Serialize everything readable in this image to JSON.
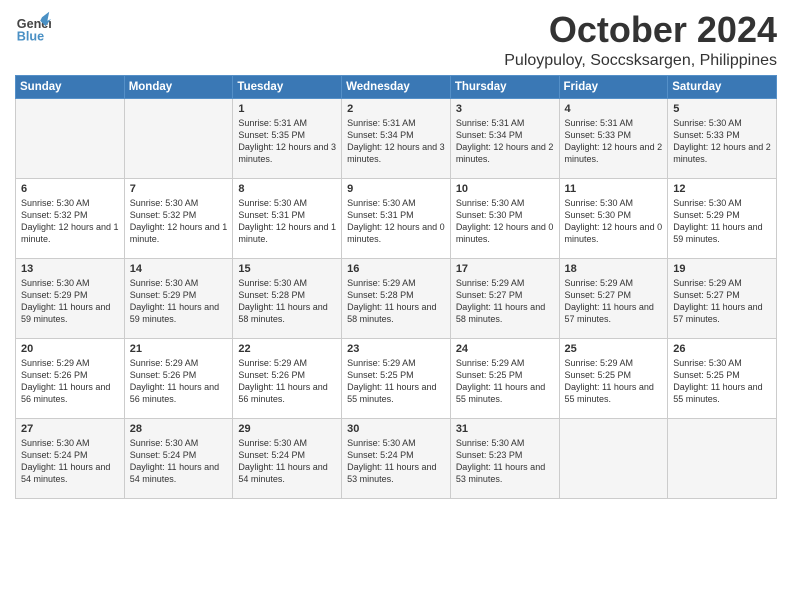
{
  "header": {
    "logo_line1": "General",
    "logo_line2": "Blue",
    "month": "October 2024",
    "location": "Puloypuloy, Soccsksargen, Philippines"
  },
  "weekdays": [
    "Sunday",
    "Monday",
    "Tuesday",
    "Wednesday",
    "Thursday",
    "Friday",
    "Saturday"
  ],
  "weeks": [
    [
      {
        "day": "",
        "content": ""
      },
      {
        "day": "",
        "content": ""
      },
      {
        "day": "1",
        "content": "Sunrise: 5:31 AM\nSunset: 5:35 PM\nDaylight: 12 hours\nand 3 minutes."
      },
      {
        "day": "2",
        "content": "Sunrise: 5:31 AM\nSunset: 5:34 PM\nDaylight: 12 hours\nand 3 minutes."
      },
      {
        "day": "3",
        "content": "Sunrise: 5:31 AM\nSunset: 5:34 PM\nDaylight: 12 hours\nand 2 minutes."
      },
      {
        "day": "4",
        "content": "Sunrise: 5:31 AM\nSunset: 5:33 PM\nDaylight: 12 hours\nand 2 minutes."
      },
      {
        "day": "5",
        "content": "Sunrise: 5:30 AM\nSunset: 5:33 PM\nDaylight: 12 hours\nand 2 minutes."
      }
    ],
    [
      {
        "day": "6",
        "content": "Sunrise: 5:30 AM\nSunset: 5:32 PM\nDaylight: 12 hours\nand 1 minute."
      },
      {
        "day": "7",
        "content": "Sunrise: 5:30 AM\nSunset: 5:32 PM\nDaylight: 12 hours\nand 1 minute."
      },
      {
        "day": "8",
        "content": "Sunrise: 5:30 AM\nSunset: 5:31 PM\nDaylight: 12 hours\nand 1 minute."
      },
      {
        "day": "9",
        "content": "Sunrise: 5:30 AM\nSunset: 5:31 PM\nDaylight: 12 hours\nand 0 minutes."
      },
      {
        "day": "10",
        "content": "Sunrise: 5:30 AM\nSunset: 5:30 PM\nDaylight: 12 hours\nand 0 minutes."
      },
      {
        "day": "11",
        "content": "Sunrise: 5:30 AM\nSunset: 5:30 PM\nDaylight: 12 hours\nand 0 minutes."
      },
      {
        "day": "12",
        "content": "Sunrise: 5:30 AM\nSunset: 5:29 PM\nDaylight: 11 hours\nand 59 minutes."
      }
    ],
    [
      {
        "day": "13",
        "content": "Sunrise: 5:30 AM\nSunset: 5:29 PM\nDaylight: 11 hours\nand 59 minutes."
      },
      {
        "day": "14",
        "content": "Sunrise: 5:30 AM\nSunset: 5:29 PM\nDaylight: 11 hours\nand 59 minutes."
      },
      {
        "day": "15",
        "content": "Sunrise: 5:30 AM\nSunset: 5:28 PM\nDaylight: 11 hours\nand 58 minutes."
      },
      {
        "day": "16",
        "content": "Sunrise: 5:29 AM\nSunset: 5:28 PM\nDaylight: 11 hours\nand 58 minutes."
      },
      {
        "day": "17",
        "content": "Sunrise: 5:29 AM\nSunset: 5:27 PM\nDaylight: 11 hours\nand 58 minutes."
      },
      {
        "day": "18",
        "content": "Sunrise: 5:29 AM\nSunset: 5:27 PM\nDaylight: 11 hours\nand 57 minutes."
      },
      {
        "day": "19",
        "content": "Sunrise: 5:29 AM\nSunset: 5:27 PM\nDaylight: 11 hours\nand 57 minutes."
      }
    ],
    [
      {
        "day": "20",
        "content": "Sunrise: 5:29 AM\nSunset: 5:26 PM\nDaylight: 11 hours\nand 56 minutes."
      },
      {
        "day": "21",
        "content": "Sunrise: 5:29 AM\nSunset: 5:26 PM\nDaylight: 11 hours\nand 56 minutes."
      },
      {
        "day": "22",
        "content": "Sunrise: 5:29 AM\nSunset: 5:26 PM\nDaylight: 11 hours\nand 56 minutes."
      },
      {
        "day": "23",
        "content": "Sunrise: 5:29 AM\nSunset: 5:25 PM\nDaylight: 11 hours\nand 55 minutes."
      },
      {
        "day": "24",
        "content": "Sunrise: 5:29 AM\nSunset: 5:25 PM\nDaylight: 11 hours\nand 55 minutes."
      },
      {
        "day": "25",
        "content": "Sunrise: 5:29 AM\nSunset: 5:25 PM\nDaylight: 11 hours\nand 55 minutes."
      },
      {
        "day": "26",
        "content": "Sunrise: 5:30 AM\nSunset: 5:25 PM\nDaylight: 11 hours\nand 55 minutes."
      }
    ],
    [
      {
        "day": "27",
        "content": "Sunrise: 5:30 AM\nSunset: 5:24 PM\nDaylight: 11 hours\nand 54 minutes."
      },
      {
        "day": "28",
        "content": "Sunrise: 5:30 AM\nSunset: 5:24 PM\nDaylight: 11 hours\nand 54 minutes."
      },
      {
        "day": "29",
        "content": "Sunrise: 5:30 AM\nSunset: 5:24 PM\nDaylight: 11 hours\nand 54 minutes."
      },
      {
        "day": "30",
        "content": "Sunrise: 5:30 AM\nSunset: 5:24 PM\nDaylight: 11 hours\nand 53 minutes."
      },
      {
        "day": "31",
        "content": "Sunrise: 5:30 AM\nSunset: 5:23 PM\nDaylight: 11 hours\nand 53 minutes."
      },
      {
        "day": "",
        "content": ""
      },
      {
        "day": "",
        "content": ""
      }
    ]
  ]
}
